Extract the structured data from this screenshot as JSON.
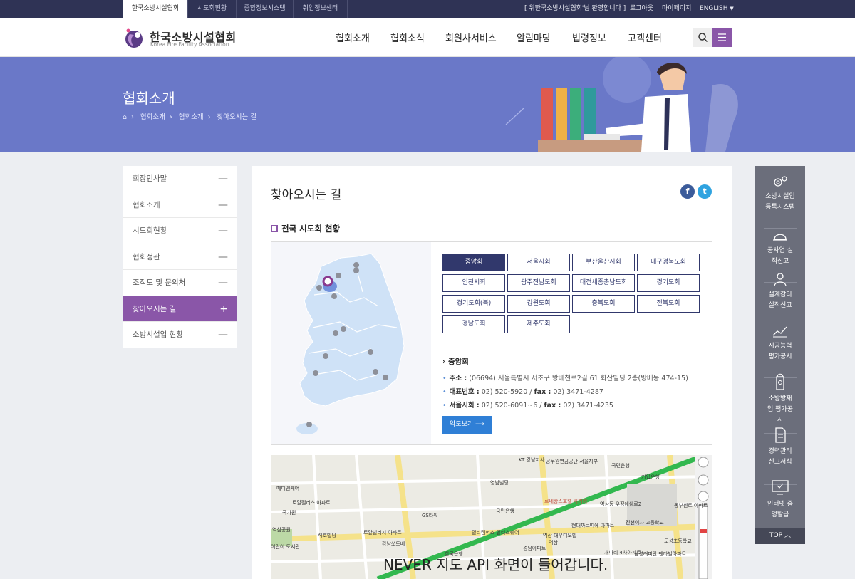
{
  "topbar": {
    "tabs": [
      "한국소방시설협회",
      "시도회현황",
      "종합정보시스템",
      "취업정보센터"
    ],
    "welcome": "[ 위한국소방시설협회'님 환영합니다 ]",
    "logout": "로그아웃",
    "mypage": "마이페이지",
    "language": "ENGLISH"
  },
  "header": {
    "logo_ko": "한국소방시설협회",
    "logo_en": "Korea Fire Facility Association",
    "nav": [
      "협회소개",
      "협회소식",
      "회원사서비스",
      "알림마당",
      "법령정보",
      "고객센터"
    ]
  },
  "banner": {
    "title": "협회소개",
    "breadcrumb": [
      "협회소개",
      "협회소개",
      "찾아오시는 길"
    ]
  },
  "sidebar": {
    "items": [
      {
        "label": "회장인사말",
        "sign": "—"
      },
      {
        "label": "협회소개",
        "sign": "—"
      },
      {
        "label": "시도회현황",
        "sign": "—"
      },
      {
        "label": "협회정관",
        "sign": "—"
      },
      {
        "label": "조직도 및 문의처",
        "sign": "—"
      },
      {
        "label": "찾아오시는 길",
        "sign": "+"
      },
      {
        "label": "소방시설업 현황",
        "sign": "—"
      }
    ]
  },
  "content": {
    "title": "찾아오시는 길",
    "section_title": "전국 시도회 현황",
    "regions": [
      "중앙회",
      "서울시회",
      "부산울산시회",
      "대구경북도회",
      "인천시회",
      "광주전남도회",
      "대전세종충남도회",
      "경기도회",
      "경기도회(북)",
      "강원도회",
      "충북도회",
      "전북도회",
      "경남도회",
      "제주도회"
    ],
    "selected_region": "중앙회",
    "info_title": "중앙회",
    "address_label": "주소 :",
    "address": "(06694) 서울특별시 서초구 방배천로2길 61 화산빌딩 2층(방배동 474-15)",
    "phone_label": "대표번호 :",
    "phone": "02) 520-5920",
    "fax_label": "fax :",
    "fax": "02) 3471-4287",
    "seoul_label": "서울시회 :",
    "seoul_phone": "02) 520-6091~6",
    "seoul_fax": "02) 3471-4235",
    "map_button": "약도보기 ⟶",
    "map_notice": "NEVER 지도 API 화면이 들어갑니다.",
    "map_labels": [
      "KT 강남지사",
      "공무원연금공단 서울지부",
      "국민은행",
      "기업은행",
      "메디앤케어",
      "영남빌딩",
      "로얄팰리스 아파트",
      "국가원",
      "르네상스호텔 사거리",
      "역삼동 우정에쉐르2",
      "동부센트 아파트",
      "GS타워",
      "국민은행",
      "현대까르띠에 아파트",
      "진선여자 고등학교",
      "역삼공원",
      "석호빌딩",
      "로얄빌리지 아파트",
      "멀티캠퍼스 멀티스퀘어",
      "역삼 대우디오빌",
      "도성초등학교",
      "어린이 도서관",
      "강남쏘도베",
      "한국은행",
      "경남아파트",
      "개나리 4차아파트",
      "삼성래미안 펜타빌아파트",
      "역삼"
    ]
  },
  "quick_menu": {
    "items": [
      "소방시설업 등록시스템",
      "공사업 실적신고",
      "설계감리 실적신고",
      "시공능력 평가공시",
      "소방방재업 평가공시",
      "경력관리 신고서식",
      "인터넷 증명발급"
    ],
    "top": "TOP"
  },
  "colors": {
    "topbar": "#2f3355",
    "banner": "#6a78c8",
    "accent_purple": "#8a56a8",
    "region_button": "#31386c",
    "map_button": "#2f7fd6",
    "quick_menu": "#6b6e7b"
  },
  "icons": [
    "home-icon",
    "search-icon",
    "menu-icon",
    "facebook-icon",
    "twitter-icon",
    "gear-icon",
    "helmet-icon",
    "worker-icon",
    "chart-icon",
    "hydrant-icon",
    "document-icon",
    "monitor-icon"
  ]
}
